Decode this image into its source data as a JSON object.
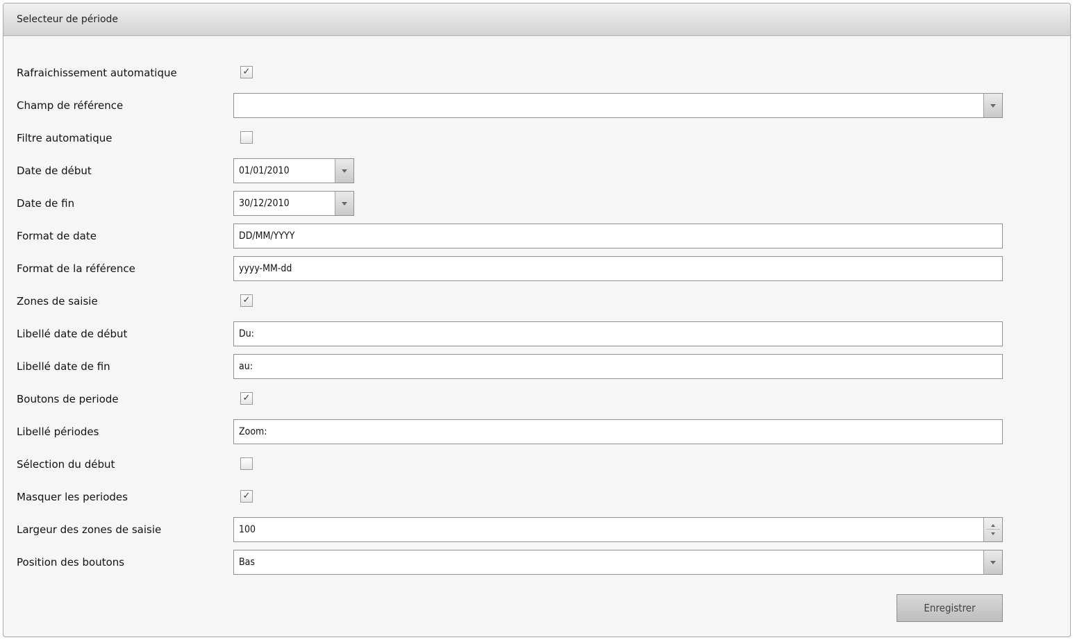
{
  "panel": {
    "title": "Selecteur de période"
  },
  "form": {
    "auto_refresh": {
      "label": "Rafraichissement automatique",
      "checked": true
    },
    "reference_field": {
      "label": "Champ de référence",
      "value": ""
    },
    "auto_filter": {
      "label": "Filtre automatique",
      "checked": false
    },
    "start_date": {
      "label": "Date de début",
      "value": "01/01/2010"
    },
    "end_date": {
      "label": "Date de fin",
      "value": "30/12/2010"
    },
    "date_format": {
      "label": "Format de date",
      "value": "DD/MM/YYYY"
    },
    "reference_format": {
      "label": "Format de la référence",
      "value": "yyyy-MM-dd"
    },
    "input_zones": {
      "label": "Zones de saisie",
      "checked": true
    },
    "start_label": {
      "label": "Libellé date de début",
      "value": "Du:"
    },
    "end_label": {
      "label": "Libellé date de fin",
      "value": "au:"
    },
    "period_buttons": {
      "label": "Boutons de periode",
      "checked": true
    },
    "periods_label": {
      "label": "Libellé périodes",
      "value": "Zoom:"
    },
    "start_selection": {
      "label": "Sélection du début",
      "checked": false
    },
    "hide_periods": {
      "label": "Masquer les periodes",
      "checked": true
    },
    "input_width": {
      "label": "Largeur des zones de saisie",
      "value": "100"
    },
    "buttons_position": {
      "label": "Position des boutons",
      "value": "Bas"
    }
  },
  "actions": {
    "save_label": "Enregistrer"
  },
  "icons": {
    "check": "✓"
  }
}
